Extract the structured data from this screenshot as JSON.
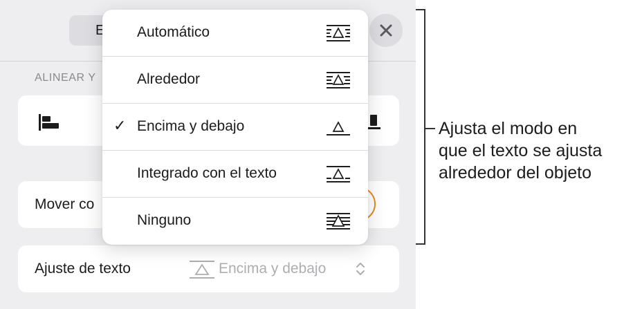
{
  "panel": {
    "tab_label": "E",
    "section_label": "ALINEAR Y",
    "move_label": "Mover co",
    "wrap_label": "Ajuste de texto",
    "wrap_value": "Encima y debajo"
  },
  "menu": {
    "items": [
      {
        "label": "Automático",
        "checked": false,
        "icon": "wrap-automatic-icon"
      },
      {
        "label": "Alrededor",
        "checked": false,
        "icon": "wrap-around-icon"
      },
      {
        "label": "Encima y debajo",
        "checked": true,
        "icon": "wrap-above-below-icon"
      },
      {
        "label": "Integrado con el texto",
        "checked": false,
        "icon": "wrap-inline-icon"
      },
      {
        "label": "Ninguno",
        "checked": false,
        "icon": "wrap-none-icon"
      }
    ],
    "check_glyph": "✓"
  },
  "callout": {
    "lines": [
      "Ajusta el modo en",
      "que el texto se ajusta",
      "alrededor del objeto"
    ]
  },
  "colors": {
    "panel_bg": "#eeeef1",
    "accent_ring": "#e08a1c",
    "muted_text": "#8a8a8e"
  }
}
